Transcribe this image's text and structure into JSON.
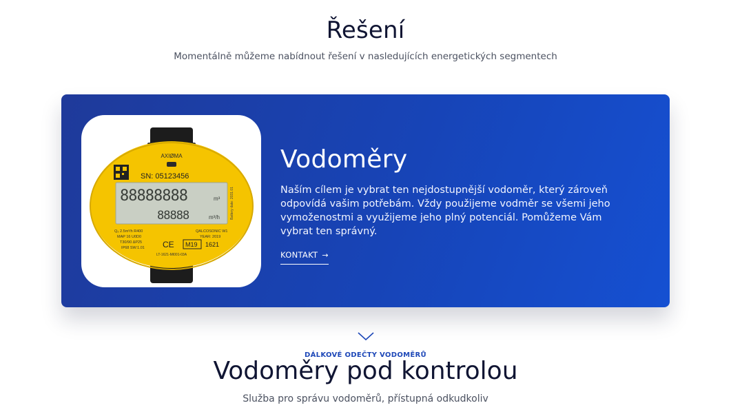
{
  "solutions": {
    "title": "Řešení",
    "subtitle": "Momentálně můžeme nabídnout řešení v nasledujících energetických segmentech"
  },
  "card": {
    "title": "Vodoměry",
    "description": "Naším cílem je vybrat ten nejdostupnější vodoměr, který zároveň odpovídá vašim potřebám. Vždy použijeme vodměr se všemi jeho vymoženostmi a využijeme jeho plný potenciál. Pomůžeme Vám vybrat ten správný.",
    "cta_label": "KONTAKT",
    "cta_icon": "arrow-right-icon",
    "image": {
      "brand": "AXIØMA",
      "serial": "SN: 05123456",
      "display_top": "88888888",
      "display_unit_top": "m³",
      "display_bottom": "88888",
      "display_unit_bottom": "m³/h",
      "model": "QALCOSONIC W1",
      "year": "YEAR: 2019",
      "spec_q": "Q₃ 2.5m³/h  R400",
      "spec_map": "MAP 16 U0D0",
      "spec_t": "T30/90  ΔP25",
      "spec_ip": "IP68 SW:1.01",
      "mark": "M19",
      "mark_num": "1621",
      "ce": "CE",
      "code": "LT-1621-MI001-03A",
      "battery_date": "Battery date: 2031.01"
    }
  },
  "section2": {
    "eyebrow": "DÁLKOVÉ ODEČTY VODOMĚRŮ",
    "title": "Vodoměry pod kontrolou",
    "subtitle": "Služba pro správu vodoměrů, přístupná odkudkoliv",
    "chevron_icon": "chevron-down-icon"
  },
  "colors": {
    "card_gradient_start": "#1f3a9a",
    "card_gradient_end": "#1550d2",
    "accent": "#1e48b8",
    "meter_yellow": "#f5c400"
  }
}
